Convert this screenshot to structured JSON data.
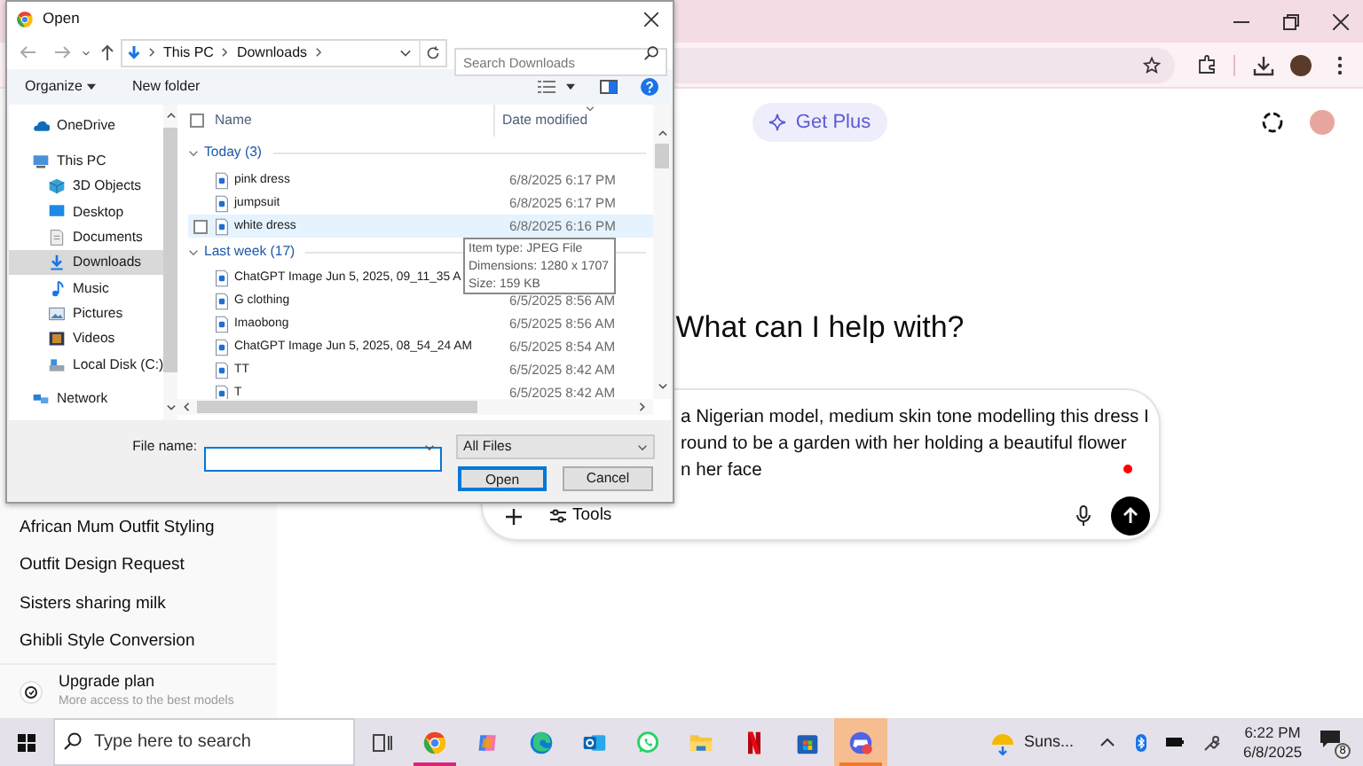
{
  "dialog": {
    "title": "Open",
    "path": [
      "This PC",
      "Downloads"
    ],
    "search": {
      "placeholder": "Search Downloads"
    },
    "commands": [
      "Organize",
      "New folder"
    ],
    "nav": [
      {
        "label": "OneDrive",
        "kind": "cloud",
        "selected": false
      },
      {
        "label": "This PC",
        "kind": "pc",
        "selected": false,
        "children": [
          {
            "label": "3D Objects",
            "kind": "cube",
            "selected": false
          },
          {
            "label": "Desktop",
            "kind": "desktop",
            "selected": false
          },
          {
            "label": "Documents",
            "kind": "documents",
            "selected": false
          },
          {
            "label": "Downloads",
            "kind": "download",
            "selected": true
          },
          {
            "label": "Music",
            "kind": "music",
            "selected": false
          },
          {
            "label": "Pictures",
            "kind": "pictures",
            "selected": false
          },
          {
            "label": "Videos",
            "kind": "videos",
            "selected": false
          },
          {
            "label": "Local Disk (C:)",
            "kind": "disk",
            "selected": false
          }
        ]
      },
      {
        "label": "Network",
        "kind": "network",
        "selected": false
      }
    ],
    "select_all": {
      "checked": false
    },
    "columns": [
      "Name",
      "Date modified"
    ],
    "groups": [
      {
        "label": "Today (3)",
        "expanded": true,
        "files": [
          {
            "name": "pink dress",
            "date": "6/8/2025 6:17 PM",
            "highlighted": false
          },
          {
            "name": "jumpsuit",
            "date": "6/8/2025 6:17 PM",
            "highlighted": false
          },
          {
            "name": "white dress",
            "date": "6/8/2025 6:16 PM",
            "highlighted": true
          }
        ]
      },
      {
        "label": "Last week (17)",
        "expanded": true,
        "files": [
          {
            "name": "ChatGPT Image Jun 5, 2025, 09_11_35 A",
            "highlighted": false
          },
          {
            "name": "G clothing",
            "date": "6/5/2025 8:56 AM",
            "highlighted": false
          },
          {
            "name": "Imaobong",
            "date": "6/5/2025 8:56 AM",
            "highlighted": false
          },
          {
            "name": "ChatGPT Image Jun 5, 2025, 08_54_24 AM",
            "date": "6/5/2025 8:54 AM",
            "highlighted": false
          },
          {
            "name": "TT",
            "date": "6/5/2025 8:42 AM",
            "highlighted": false
          },
          {
            "name": "T",
            "date": "6/5/2025 8:42 AM",
            "highlighted": false
          }
        ]
      }
    ],
    "tooltip": [
      "Item type: JPEG File",
      "Dimensions: 1280 x 1707",
      "Size: 159 KB"
    ],
    "file_name": {
      "label": "File name:"
    },
    "file_type": "All Files",
    "buttons": [
      {
        "label": "Open",
        "default": true
      },
      {
        "label": "Cancel",
        "default": false
      }
    ]
  },
  "sidebar": {
    "chats": [
      "African Mum Outfit Styling",
      "Outfit Design Request",
      "Sisters sharing milk",
      "Ghibli Style Conversion"
    ],
    "upgrade": {
      "title": "Upgrade plan",
      "subtitle": "More access to the best models"
    }
  },
  "main": {
    "get_plus": "Get Plus",
    "heading": "What can I help with?",
    "prompt_lines": [
      "a Nigerian model, medium skin tone modelling this dress I",
      "round to be a garden with her holding a beautiful flower",
      "n her face"
    ],
    "tools": "Tools"
  },
  "taskbar": {
    "search": {
      "placeholder": "Type here to search"
    },
    "apps": [
      {
        "kind": "chrome",
        "running": true,
        "selected": false
      },
      {
        "kind": "copilot",
        "running": false,
        "selected": false
      },
      {
        "kind": "edge",
        "running": false,
        "selected": false
      },
      {
        "kind": "outlook",
        "running": false,
        "selected": false
      },
      {
        "kind": "whatsapp",
        "running": false,
        "selected": false
      },
      {
        "kind": "explorer",
        "running": false,
        "selected": false
      },
      {
        "kind": "netflix",
        "running": false,
        "selected": false
      },
      {
        "kind": "store",
        "running": false,
        "selected": false
      },
      {
        "kind": "game",
        "running": false,
        "selected": true
      }
    ],
    "weather": "Suns...",
    "time": "6:22 PM",
    "date": "6/8/2025",
    "notifications": "8"
  }
}
